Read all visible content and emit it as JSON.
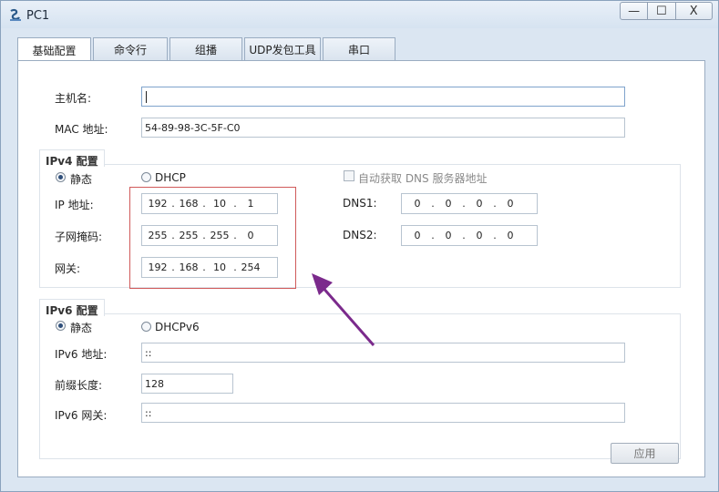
{
  "window": {
    "title": "PC1",
    "buttons": [
      "—",
      "☐",
      "X"
    ]
  },
  "tabs": [
    "基础配置",
    "命令行",
    "组播",
    "UDP发包工具",
    "串口"
  ],
  "basic": {
    "hostname_label": "主机名:",
    "hostname_value": "",
    "mac_label": "MAC 地址:",
    "mac_value": "54-89-98-3C-5F-C0"
  },
  "ipv4": {
    "group_title": "IPv4 配置",
    "static_label": "静态",
    "dhcp_label": "DHCP",
    "auto_dns_label": "自动获取 DNS 服务器地址",
    "ip_label": "IP 地址:",
    "ip": [
      "192",
      "168",
      "10",
      "1"
    ],
    "mask_label": "子网掩码:",
    "mask": [
      "255",
      "255",
      "255",
      "0"
    ],
    "gateway_label": "网关:",
    "gateway": [
      "192",
      "168",
      "10",
      "254"
    ],
    "dns1_label": "DNS1:",
    "dns1": [
      "0",
      "0",
      "0",
      "0"
    ],
    "dns2_label": "DNS2:",
    "dns2": [
      "0",
      "0",
      "0",
      "0"
    ]
  },
  "ipv6": {
    "group_title": "IPv6 配置",
    "static_label": "静态",
    "dhcp_label": "DHCPv6",
    "addr_label": "IPv6 地址:",
    "addr_value": "::",
    "prefix_label": "前缀长度:",
    "prefix_value": "128",
    "gateway_label": "IPv6 网关:",
    "gateway_value": "::"
  },
  "apply_label": "应用",
  "colors": {
    "highlight": "#d05a5a",
    "arrow": "#7b2a8c"
  }
}
